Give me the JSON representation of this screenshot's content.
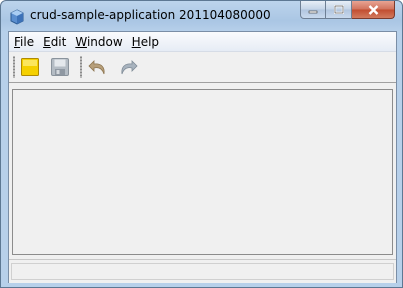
{
  "window": {
    "title": "crud-sample-application 201104080000",
    "app_icon": "netbeans-cube-icon",
    "caption_buttons": [
      "minimize-icon",
      "maximize-icon",
      "close-icon"
    ]
  },
  "menubar": {
    "items": [
      {
        "mnemonic": "F",
        "rest": "ile"
      },
      {
        "mnemonic": "E",
        "rest": "dit"
      },
      {
        "mnemonic": "W",
        "rest": "indow"
      },
      {
        "mnemonic": "H",
        "rest": "elp"
      }
    ]
  },
  "toolbar": {
    "buttons": [
      {
        "icon": "new-file-icon",
        "enabled": true
      },
      {
        "icon": "save-icon",
        "enabled": false
      },
      {
        "icon": "undo-icon",
        "enabled": false
      },
      {
        "icon": "redo-icon",
        "enabled": false
      }
    ]
  },
  "colors": {
    "window_frame": "#aac6e4",
    "close_button": "#c14c2f",
    "new_icon": "#f5d000",
    "disabled_icon": "#9aa4ae",
    "undo_icon": "#b79f7a"
  },
  "statusbar": {
    "text": ""
  }
}
